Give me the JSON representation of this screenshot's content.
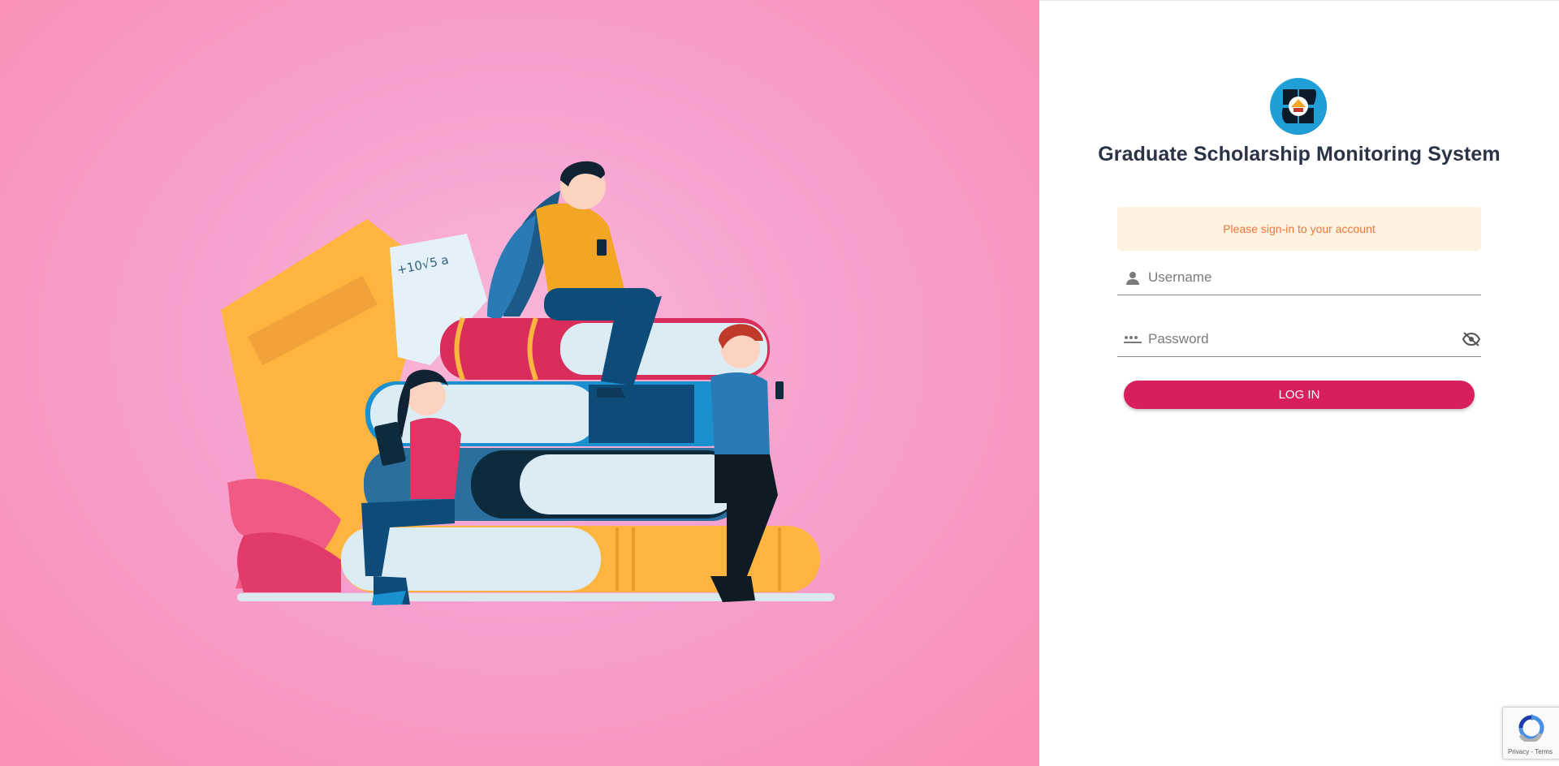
{
  "app": {
    "title": "Graduate Scholarship Monitoring System"
  },
  "logo": {
    "icon": "university-seal-logo"
  },
  "hero": {
    "illustration": "students-reading-on-books"
  },
  "form": {
    "alert_text": "Please sign-in to your account",
    "username": {
      "value": "",
      "placeholder": "Username",
      "icon": "person-icon"
    },
    "password": {
      "value": "",
      "placeholder": "Password",
      "icon": "password-dots-icon",
      "toggle_icon": "eye-off-icon"
    },
    "login_label": "LOG IN"
  },
  "recaptcha": {
    "links": "Privacy - Terms"
  },
  "colors": {
    "hero_bg": "#f7a0cd",
    "primary_button": "#d81e5b",
    "alert_bg": "#fff2e1",
    "alert_text": "#e8763b",
    "title_text": "#2b3447"
  }
}
